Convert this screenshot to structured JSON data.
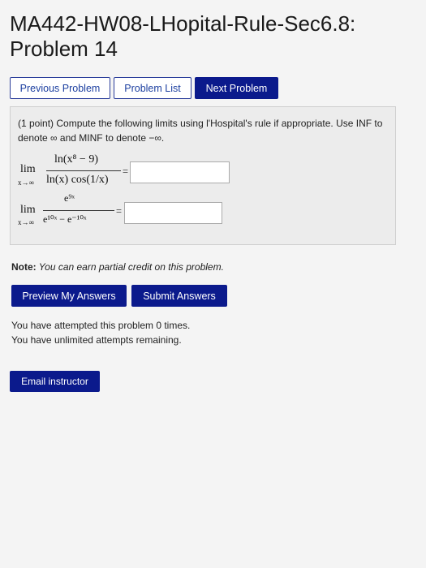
{
  "header": {
    "title_line1": "MA442-HW08-LHopital-Rule-Sec6.8:",
    "title_line2": "Problem 14"
  },
  "nav": {
    "previous": "Previous Problem",
    "list": "Problem List",
    "next": "Next Problem"
  },
  "problem": {
    "prompt": "(1 point) Compute the following limits using l'Hospital's rule if appropriate. Use INF to denote ∞ and MINF to denote −∞.",
    "q1": {
      "lim": "lim",
      "sub": "x→∞",
      "numerator": "ln(x⁸ − 9)",
      "denominator": "ln(x) cos(1/x)",
      "equals": "=",
      "answer": ""
    },
    "q2": {
      "lim": "lim",
      "sub": "x→∞",
      "numerator": "e⁹ˣ",
      "denominator": "e¹⁰ˣ − e⁻¹⁰ˣ",
      "equals": "=",
      "answer": ""
    }
  },
  "note": {
    "label": "Note:",
    "text": "You can earn partial credit on this problem."
  },
  "actions": {
    "preview": "Preview My Answers",
    "submit": "Submit Answers"
  },
  "attempts": {
    "line1": "You have attempted this problem 0 times.",
    "line2": "You have unlimited attempts remaining."
  },
  "email": "Email instructor"
}
